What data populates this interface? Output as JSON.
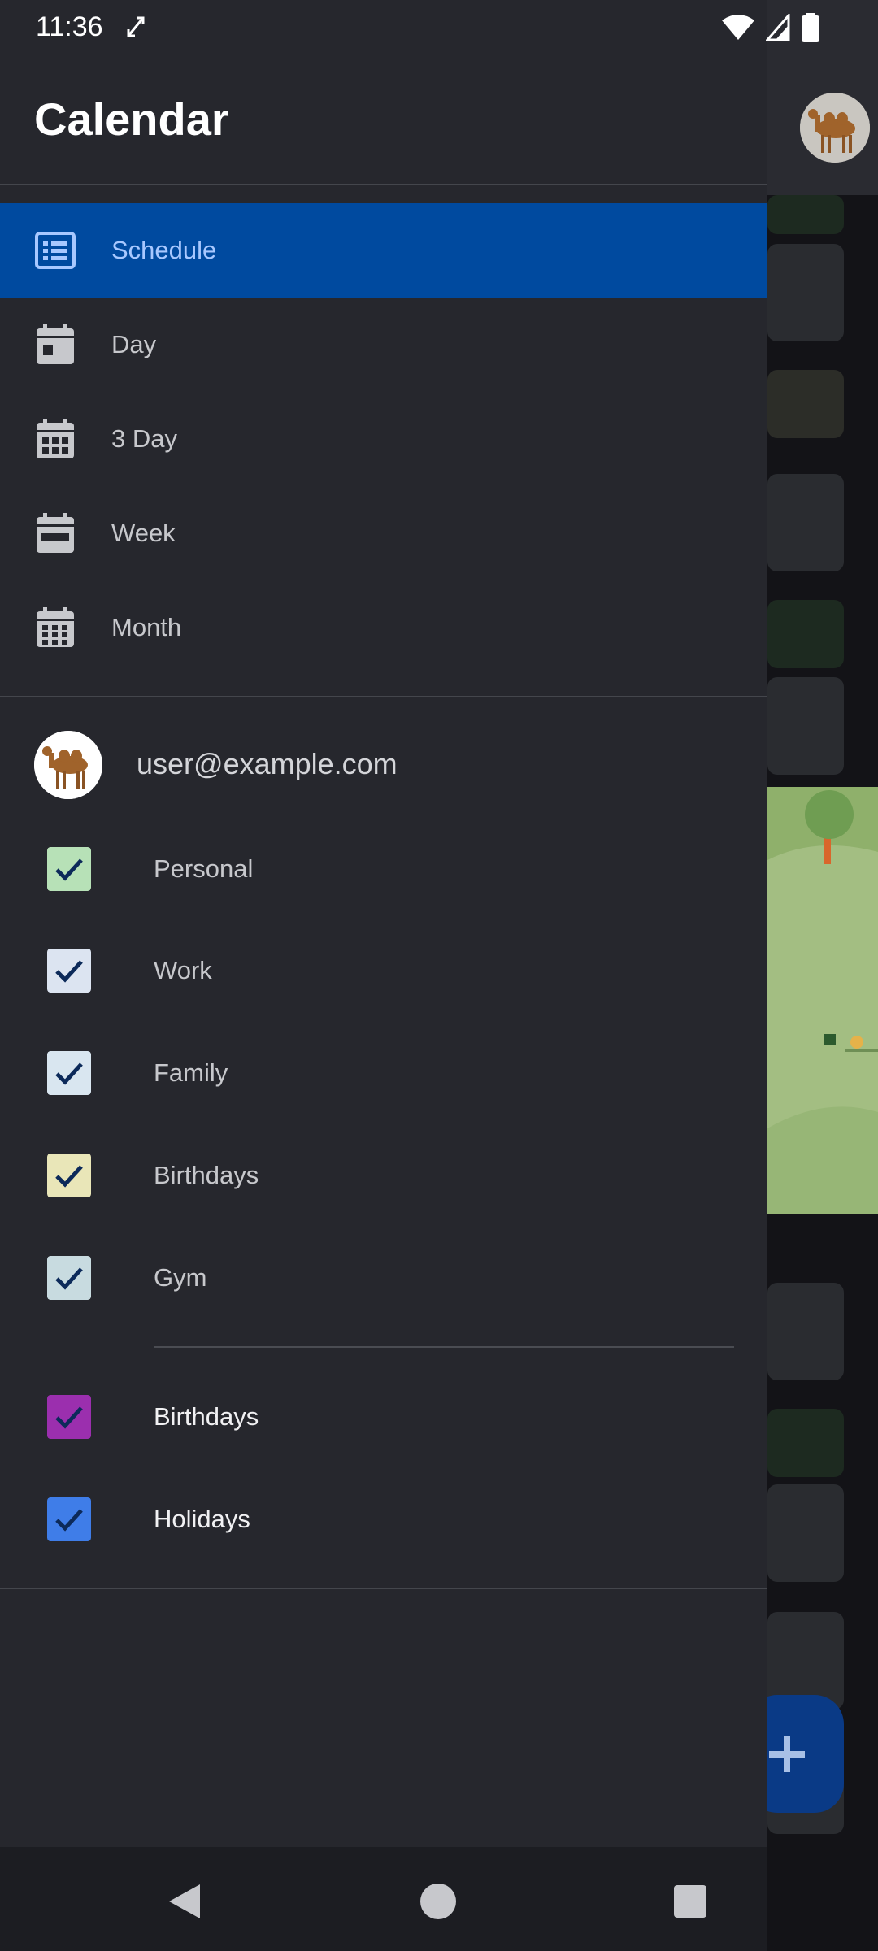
{
  "status_bar": {
    "time": "11:36"
  },
  "drawer": {
    "title": "Calendar",
    "views": [
      {
        "label": "Schedule",
        "icon": "schedule-list-icon",
        "active": true
      },
      {
        "label": "Day",
        "icon": "calendar-day-icon",
        "active": false
      },
      {
        "label": "3 Day",
        "icon": "calendar-3day-icon",
        "active": false
      },
      {
        "label": "Week",
        "icon": "calendar-week-icon",
        "active": false
      },
      {
        "label": "Month",
        "icon": "calendar-month-icon",
        "active": false
      }
    ],
    "account": {
      "email": "user@example.com"
    },
    "calendars": [
      {
        "label": "Personal",
        "checked": true,
        "color": "#b7e1b7"
      },
      {
        "label": "Work",
        "checked": true,
        "color": "#dce4f1"
      },
      {
        "label": "Family",
        "checked": true,
        "color": "#d9e6f0"
      },
      {
        "label": "Birthdays",
        "checked": true,
        "color": "#e9e6b8"
      },
      {
        "label": "Gym",
        "checked": true,
        "color": "#c8dbe0"
      }
    ],
    "other_calendars": [
      {
        "label": "Birthdays",
        "checked": true,
        "color": "#9b2fae"
      },
      {
        "label": "Holidays",
        "checked": true,
        "color": "#3f7de8"
      }
    ]
  },
  "colors": {
    "drawer_bg": "#26272d",
    "active_item_bg": "#004a9f",
    "active_item_text": "#a8c8ff",
    "check_mark": "#0c2a5a"
  }
}
